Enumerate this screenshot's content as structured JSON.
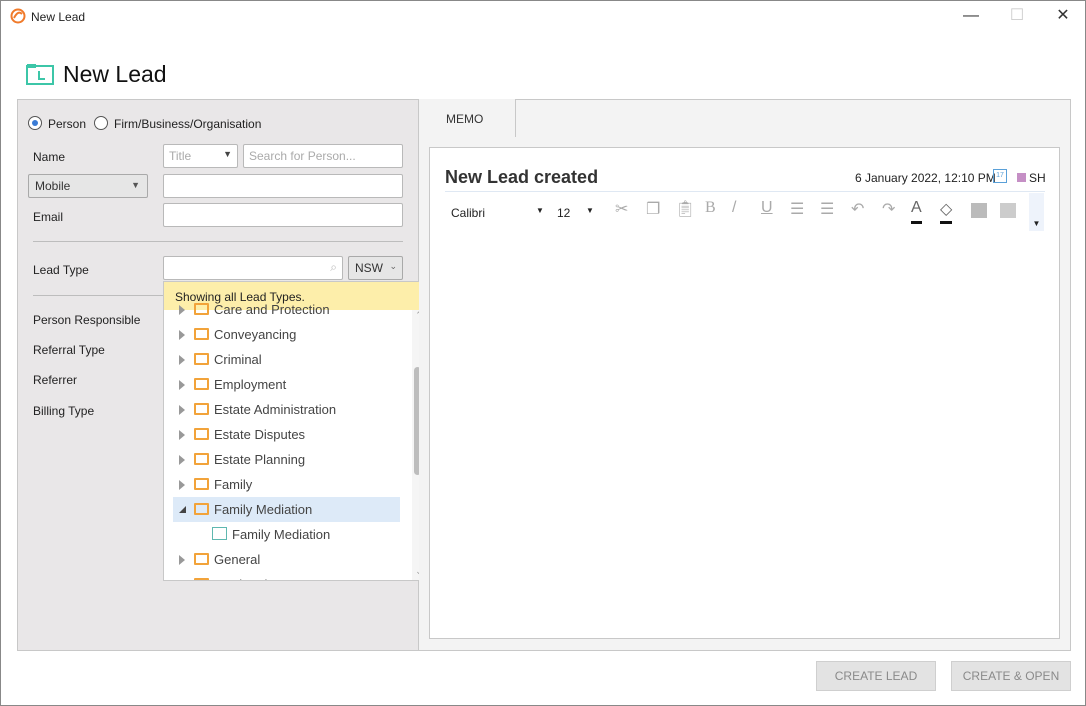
{
  "window": {
    "title": "New Lead",
    "controls": [
      "—",
      "☐",
      "✕"
    ]
  },
  "header": {
    "title": "New Lead"
  },
  "form": {
    "entity_types": [
      {
        "label": "Person",
        "selected": true
      },
      {
        "label": "Firm/Business/Organisation",
        "selected": false
      }
    ],
    "name_label": "Name",
    "title_placeholder": "Title",
    "search_person_placeholder": "Search for Person...",
    "phone_type": "Mobile",
    "phone_value": "",
    "email_label": "Email",
    "email_value": "",
    "lead_type_label": "Lead Type",
    "lead_type_value": "",
    "state": "NSW",
    "person_responsible_label": "Person Responsible",
    "referral_type_label": "Referral Type",
    "referrer_label": "Referrer",
    "billing_type_label": "Billing Type"
  },
  "dropdown": {
    "tip": "Showing all Lead Types.",
    "items": [
      {
        "label": "Care and Protection",
        "type": "folder"
      },
      {
        "label": "Conveyancing",
        "type": "folder"
      },
      {
        "label": "Criminal",
        "type": "folder"
      },
      {
        "label": "Employment",
        "type": "folder"
      },
      {
        "label": "Estate Administration",
        "type": "folder"
      },
      {
        "label": "Estate Disputes",
        "type": "folder"
      },
      {
        "label": "Estate Planning",
        "type": "folder"
      },
      {
        "label": "Family",
        "type": "folder"
      },
      {
        "label": "Family Mediation",
        "type": "folder",
        "expanded": true,
        "selected": true
      },
      {
        "label": "Family Mediation",
        "type": "lead",
        "child": true
      },
      {
        "label": "General",
        "type": "folder"
      },
      {
        "label": "Immigration",
        "type": "folder"
      }
    ]
  },
  "memo": {
    "tab": "MEMO",
    "heading": "New Lead created",
    "datetime": "6 January 2022, 12:10 PM",
    "user": "SH",
    "user_color": "#c58fc5",
    "font": "Calibri",
    "size": "12"
  },
  "buttons": {
    "create_lead": "CREATE LEAD",
    "create_open": "CREATE & OPEN"
  },
  "colors": {
    "accent": "#3a7bd5",
    "folder": "#f2a33a",
    "lead_icon": "#3cc6a8",
    "tip_bg": "#fdeeaa"
  }
}
